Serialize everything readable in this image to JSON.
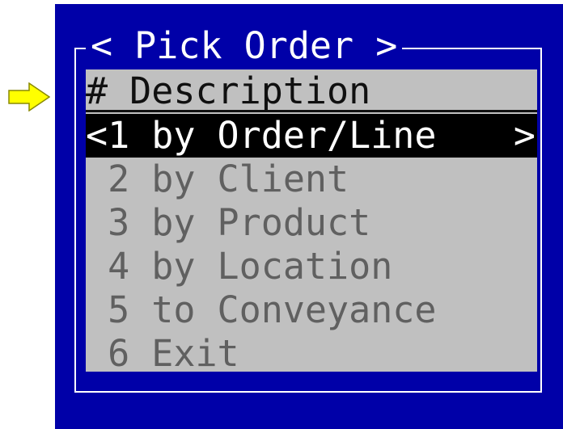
{
  "pointer": {
    "icon": "arrow-right-icon",
    "color": "#ffff00"
  },
  "window": {
    "title": "< Pick Order >",
    "background": "#0000a8",
    "list_background": "#c0c0c0",
    "selected_background": "#000000"
  },
  "list": {
    "header": "# Description",
    "items": [
      {
        "label": "<1 by Order/Line",
        "end": ">",
        "selected": true
      },
      {
        "label": " 2 by Client"
      },
      {
        "label": " 3 by Product"
      },
      {
        "label": " 4 by Location"
      },
      {
        "label": " 5 to Conveyance"
      },
      {
        "label": " 6 Exit"
      }
    ]
  }
}
